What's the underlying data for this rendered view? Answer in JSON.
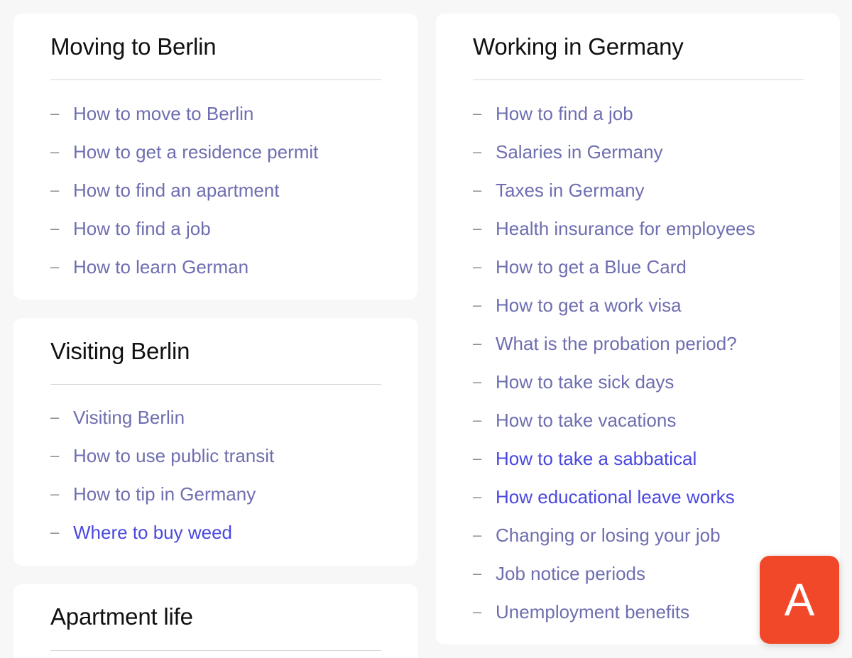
{
  "sections": {
    "moving": {
      "title": "Moving to Berlin",
      "items": [
        {
          "label": "How to move to Berlin"
        },
        {
          "label": "How to get a residence permit"
        },
        {
          "label": "How to find an apartment"
        },
        {
          "label": "How to find a job"
        },
        {
          "label": "How to learn German"
        }
      ]
    },
    "visiting": {
      "title": "Visiting Berlin",
      "items": [
        {
          "label": "Visiting Berlin"
        },
        {
          "label": "How to use public transit"
        },
        {
          "label": "How to tip in Germany"
        },
        {
          "label": "Where to buy weed"
        }
      ]
    },
    "apartment": {
      "title": "Apartment life"
    },
    "working": {
      "title": "Working in Germany",
      "items": [
        {
          "label": "How to find a job"
        },
        {
          "label": "Salaries in Germany"
        },
        {
          "label": "Taxes in Germany"
        },
        {
          "label": "Health insurance for employees"
        },
        {
          "label": "How to get a Blue Card"
        },
        {
          "label": "How to get a work visa"
        },
        {
          "label": "What is the probation period?"
        },
        {
          "label": "How to take sick days"
        },
        {
          "label": "How to take vacations"
        },
        {
          "label": "How to take a sabbatical"
        },
        {
          "label": "How educational leave works"
        },
        {
          "label": "Changing or losing your job"
        },
        {
          "label": "Job notice periods"
        },
        {
          "label": "Unemployment benefits"
        }
      ]
    }
  },
  "list_marker": "–",
  "badge": {
    "letter": "A"
  },
  "colors": {
    "background": "#f7f7f7",
    "card": "#ffffff",
    "link": "#6e6eb0",
    "link_highlight": "#4a48e0",
    "badge": "#f2482a"
  }
}
